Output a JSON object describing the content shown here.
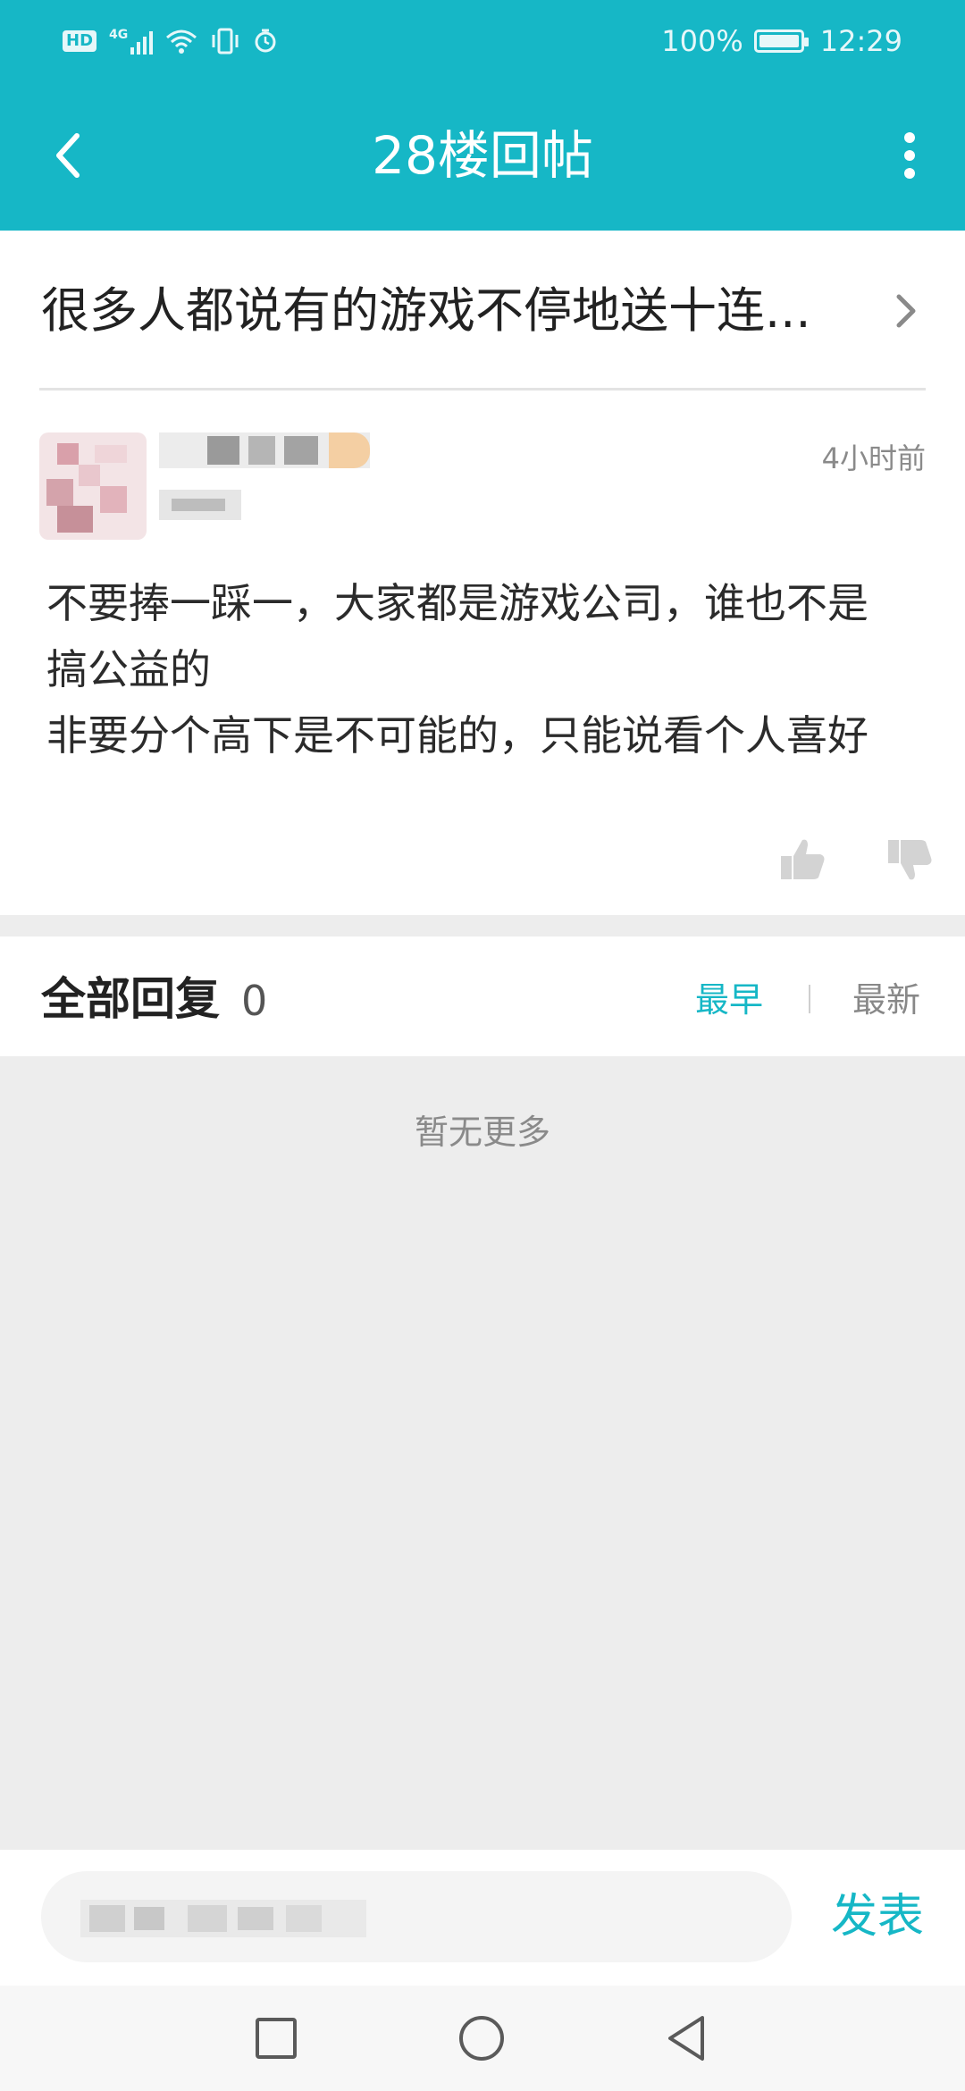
{
  "status_bar": {
    "hd_label": "HD",
    "network": "4G",
    "battery_percent": "100%",
    "time": "12:29"
  },
  "header": {
    "title": "28楼回帖",
    "accent_color": "#16b7c6"
  },
  "thread": {
    "title": "很多人都说有的游戏不停地送十连..."
  },
  "post": {
    "time": "4小时前",
    "body_lines": [
      "不要捧一踩一，大家都是游戏公司，谁也不是",
      "搞公益的",
      "非要分个高下是不可能的，只能说看个人喜好"
    ]
  },
  "replies": {
    "title": "全部回复",
    "count": "0",
    "sort_earliest": "最早",
    "sort_newest": "最新",
    "empty_text": "暂无更多"
  },
  "composer": {
    "send_label": "发表"
  },
  "icons": {
    "back": "chevron-left-icon",
    "more": "more-vertical-icon",
    "thread_arrow": "chevron-right-icon",
    "like": "thumbs-up-icon",
    "dislike": "thumbs-down-icon",
    "nav_recent": "square-icon",
    "nav_home": "circle-icon",
    "nav_back": "triangle-back-icon"
  }
}
